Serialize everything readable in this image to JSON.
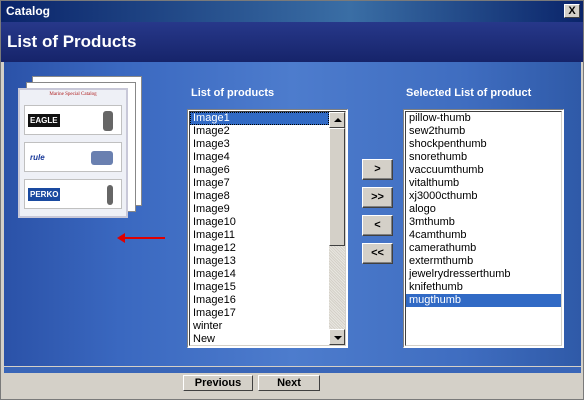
{
  "window": {
    "title": "Catalog",
    "close_glyph": "X"
  },
  "header": {
    "title": "List of Products"
  },
  "illustration": {
    "catalog_title": "Marine Special Catalog",
    "brands": [
      "EAGLE",
      "rule",
      "PERKO"
    ]
  },
  "products": {
    "label": "List of products",
    "items": [
      "Image1",
      "Image2",
      "Image3",
      "Image4",
      "Image6",
      "Image7",
      "Image8",
      "Image9",
      "Image10",
      "Image11",
      "Image12",
      "Image13",
      "Image14",
      "Image15",
      "Image16",
      "Image17",
      "winter",
      "New"
    ],
    "selected_index": 0
  },
  "selected": {
    "label": "Selected List of product",
    "items": [
      "pillow-thumb",
      "sew2thumb",
      "shockpenthumb",
      "snorethumb",
      "vaccuumthumb",
      "vitalthumb",
      "xj3000cthumb",
      "alogo",
      "3mthumb",
      "4camthumb",
      "camerathumb",
      "extermthumb",
      "jewelrydresserthumb",
      "knifethumb",
      "mugthumb"
    ],
    "selected_index": 14
  },
  "move_buttons": {
    "add": ">",
    "add_all": ">>",
    "remove": "<",
    "remove_all": "<<"
  },
  "nav": {
    "previous": "Previous",
    "next": "Next"
  },
  "colors": {
    "selection": "#316ac5",
    "header": "#1e2f7a",
    "title_bar": "#0a246a",
    "arrow": "#e00000"
  }
}
